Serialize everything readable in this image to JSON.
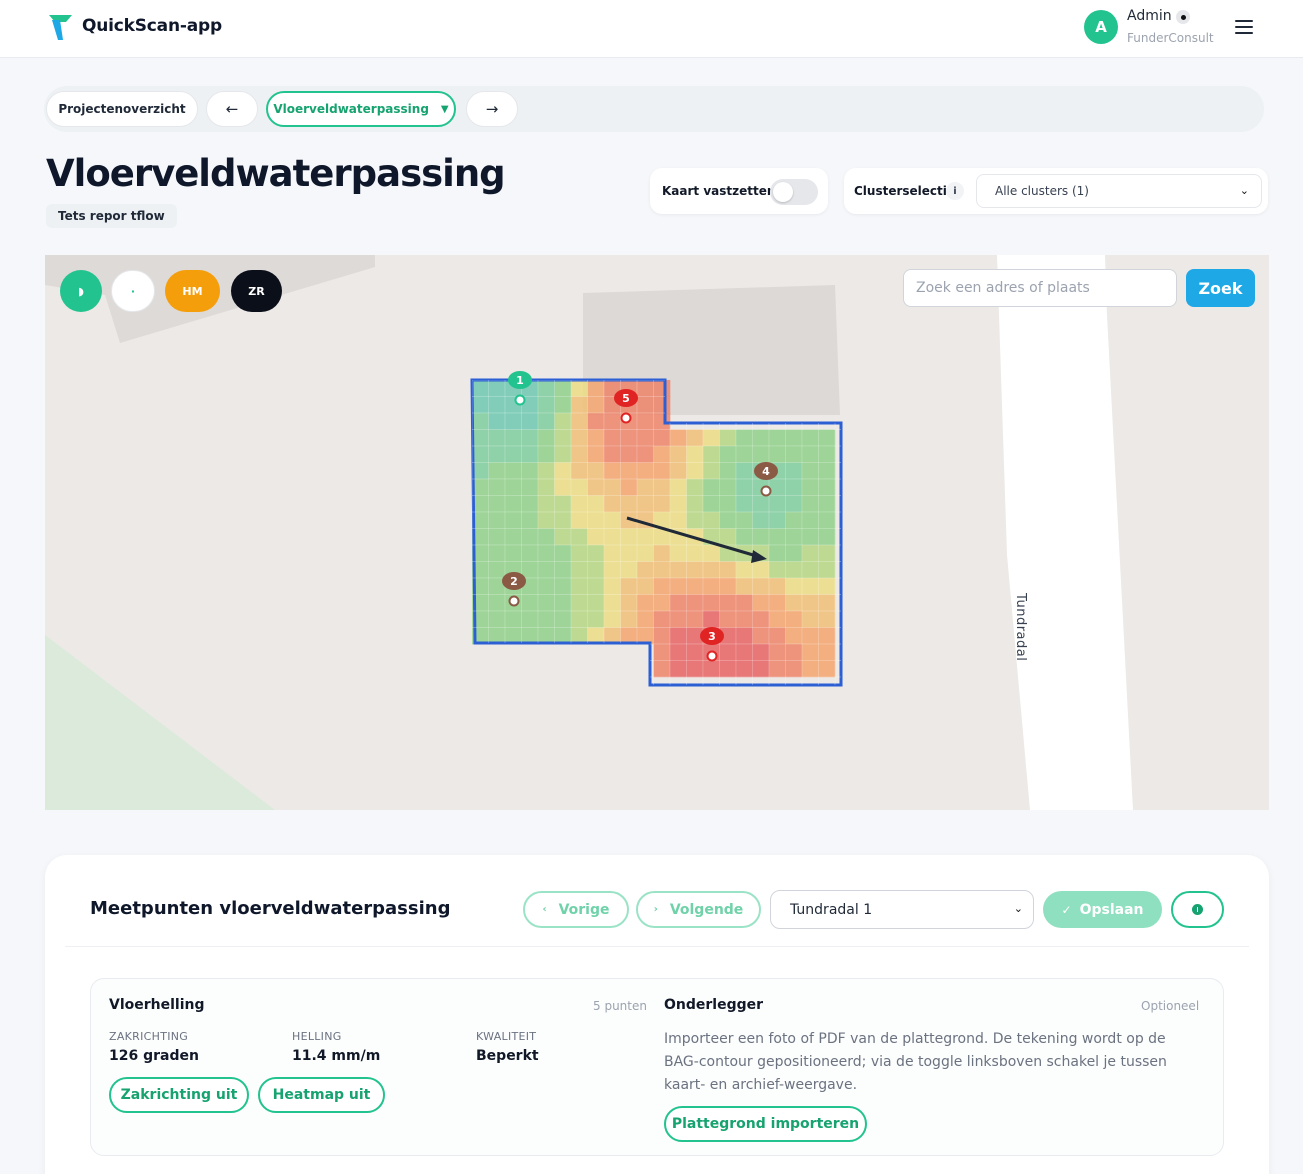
{
  "header": {
    "app_name": "QuickScan-app",
    "user_initial": "A",
    "user_name": "Admin",
    "user_org": "FunderConsult"
  },
  "breadcrumb": {
    "overview": "Projectenoverzicht",
    "prev_arrow": "←",
    "current": "Vloerveldwaterpassing",
    "next_arrow": "→"
  },
  "page": {
    "title": "Vloerveldwaterpassing",
    "project_tag": "Tets repor tflow"
  },
  "controls": {
    "lock_label": "Kaart vastzetten",
    "lock_on": false,
    "cluster_label": "Clusterselectie",
    "cluster_info": "i",
    "cluster_value": "Alle clusters (1)"
  },
  "map": {
    "mode_buttons": [
      {
        "label": "◗",
        "color": "#22c38e"
      },
      {
        "label": "·",
        "color": "#ffffff"
      },
      {
        "label": "HM",
        "color": "#f59e0b"
      },
      {
        "label": "ZR",
        "color": "#0b0f19"
      }
    ],
    "search_placeholder": "Zoek een adres of plaats",
    "search_button": "Zoek",
    "street_label": "Tundradal",
    "points": [
      {
        "id": "1",
        "color": "#22c38e"
      },
      {
        "id": "2",
        "color": "#8b5a45"
      },
      {
        "id": "3",
        "color": "#e02424"
      },
      {
        "id": "4",
        "color": "#8b5a45"
      },
      {
        "id": "5",
        "color": "#e02424"
      }
    ]
  },
  "panel": {
    "title": "Meetpunten vloerveldwaterpassing",
    "prev": "Vorige",
    "next": "Volgende",
    "address": "Tundradal 1",
    "save": "Opslaan",
    "slope": {
      "heading": "Vloerhelling",
      "count": "5 punten",
      "direction_label": "ZAKRICHTING",
      "direction_value": "126 graden",
      "slope_label": "HELLING",
      "slope_value": "11.4 mm/m",
      "quality_label": "KWALITEIT",
      "quality_value": "Beperkt",
      "direction_toggle": "Zakrichting uit",
      "heatmap_toggle": "Heatmap uit"
    },
    "underlay": {
      "heading": "Onderlegger",
      "optional": "Optioneel",
      "description": "Importeer een foto of PDF van de plattegrond. De tekening wordt op de BAG-contour gepositioneerd; via de toggle linksboven schakel je tussen kaart- en archief-weergave.",
      "import_button": "Plattegrond importeren"
    }
  },
  "colors": {
    "accent_green": "#22c38e",
    "search_blue": "#1ea8e6",
    "contour_blue": "#2c5fd4"
  }
}
